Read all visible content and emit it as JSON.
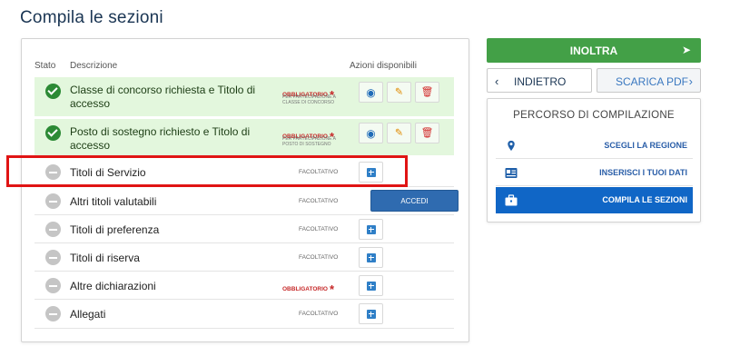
{
  "page_title": "Compila le sezioni",
  "table": {
    "headers": {
      "stato": "Stato",
      "descrizione": "Descrizione",
      "azioni": "Azioni disponibili"
    },
    "rows": [
      {
        "label": "Classe di concorso richiesta e Titolo di accesso",
        "requirement": "OBBLIGATORIO",
        "note": "PER PARTECIPAZIONE A CLASSE DI CONCORSO",
        "status": "completed"
      },
      {
        "label": "Posto di sostegno richiesto e Titolo di accesso",
        "requirement": "OBBLIGATORIO",
        "note": "PER PARTECIPAZIONE A POSTO DI SOSTEGNO",
        "status": "completed"
      },
      {
        "label": "Titoli di Servizio",
        "requirement": "FACOLTATIVO",
        "status": "empty"
      },
      {
        "label": "Altri titoli valutabili",
        "requirement": "FACOLTATIVO",
        "status": "empty",
        "action_label": "ACCEDI"
      },
      {
        "label": "Titoli di preferenza",
        "requirement": "FACOLTATIVO",
        "status": "empty"
      },
      {
        "label": "Titoli di riserva",
        "requirement": "FACOLTATIVO",
        "status": "empty"
      },
      {
        "label": "Altre dichiarazioni",
        "requirement": "OBBLIGATORIO",
        "status": "empty"
      },
      {
        "label": "Allegati",
        "requirement": "FACOLTATIVO",
        "status": "empty"
      }
    ],
    "required_star": "*"
  },
  "actions": {
    "inoltra": "INOLTRA",
    "indietro": "INDIETRO",
    "scarica_pdf": "SCARICA PDF",
    "chevron_left": "‹",
    "chevron_right": "›",
    "send_glyph": "➤"
  },
  "path": {
    "title": "PERCORSO DI COMPILAZIONE",
    "steps": [
      {
        "label": "SCEGLI LA REGIONE",
        "icon": "map-marker-icon"
      },
      {
        "label": "INSERISCI I TUOI DATI",
        "icon": "id-card-icon"
      },
      {
        "label": "COMPILA LE SEZIONI",
        "icon": "briefcase-icon",
        "active": true
      }
    ]
  },
  "colors": {
    "primary": "#1066c6",
    "success": "#43a047",
    "required": "#c62828",
    "highlight": "#e01414"
  }
}
